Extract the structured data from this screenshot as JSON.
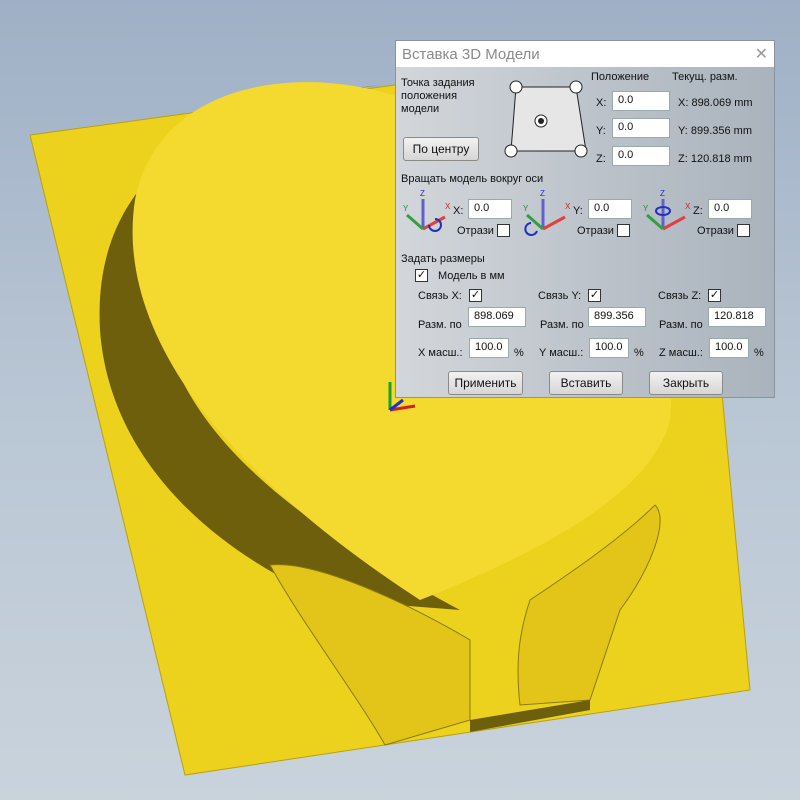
{
  "dialog": {
    "title": "Вставка 3D Модели",
    "anchor_label": "Точка задания положения модели",
    "center_button": "По центру",
    "position_header": "Положение",
    "current_size_header": "Текущ. разм.",
    "position": [
      {
        "axis": "X:",
        "value": "0.0"
      },
      {
        "axis": "Y:",
        "value": "0.0"
      },
      {
        "axis": "Z:",
        "value": "0.0"
      }
    ],
    "current_size": [
      "X: 898.069 mm",
      "Y: 899.356 mm",
      "Z: 120.818 mm"
    ],
    "rotate_label": "Вращать модель вокруг оси",
    "rotate": [
      {
        "axis": "X:",
        "value": "0.0",
        "mirror": "Отрази",
        "mirror_checked": false
      },
      {
        "axis": "Y:",
        "value": "0.0",
        "mirror": "Отрази",
        "mirror_checked": false
      },
      {
        "axis": "Z:",
        "value": "0.0",
        "mirror": "Отрази",
        "mirror_checked": false
      }
    ],
    "sizes_label": "Задать размеры",
    "model_mm_label": "Модель в мм",
    "model_mm_checked": true,
    "dims": [
      {
        "link": "Связь X:",
        "linked": true,
        "size_label": "Разм. по",
        "size": "898.069",
        "scale_label": "X масш.:",
        "scale": "100.0",
        "pct": "%"
      },
      {
        "link": "Связь Y:",
        "linked": true,
        "size_label": "Разм. по",
        "size": "899.356",
        "scale_label": "Y масш.:",
        "scale": "100.0",
        "pct": "%"
      },
      {
        "link": "Связь Z:",
        "linked": true,
        "size_label": "Разм. по",
        "size": "120.818",
        "scale_label": "Z масш.:",
        "scale": "100.0",
        "pct": "%"
      }
    ],
    "apply": "Применить",
    "insert": "Вставить",
    "close": "Закрыть",
    "axis_letters": {
      "x": "X",
      "y": "Y",
      "z": "Z"
    }
  },
  "colors": {
    "model": "#f2d21a",
    "shadow": "#7a6a10"
  }
}
